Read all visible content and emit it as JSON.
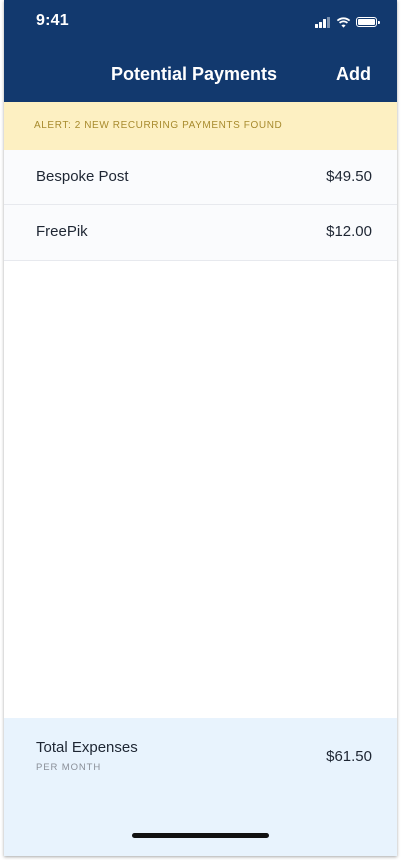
{
  "status_bar": {
    "time": "9:41",
    "icons": [
      "signal-icon",
      "wifi-icon",
      "battery-icon"
    ]
  },
  "nav": {
    "title": "Potential Payments",
    "add_label": "Add"
  },
  "alert": {
    "text": "ALERT: 2 NEW RECURRING PAYMENTS FOUND"
  },
  "payments": [
    {
      "name": "Bespoke Post",
      "amount": "$49.50"
    },
    {
      "name": "FreePik",
      "amount": "$12.00"
    }
  ],
  "footer": {
    "label": "Total Expenses",
    "sublabel": "PER MONTH",
    "amount": "$61.50"
  },
  "colors": {
    "header": "#12396e",
    "alert_bg": "#fdf0c2",
    "alert_text": "#a88b2e",
    "footer_bg": "#e8f3fd"
  }
}
